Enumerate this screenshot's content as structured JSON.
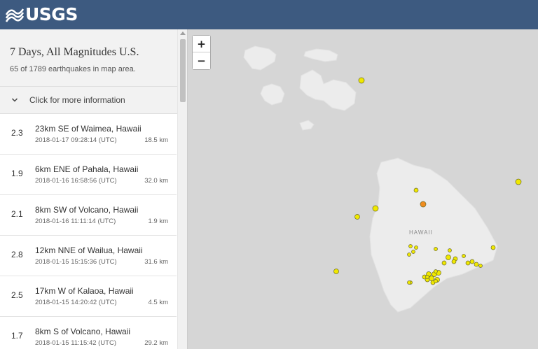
{
  "header": {
    "logo_text": "USGS"
  },
  "summary": {
    "title": "7 Days, All Magnitudes U.S.",
    "count_text": "65 of 1789 earthquakes in map area."
  },
  "more_info": {
    "label": "Click for more information"
  },
  "earthquakes": [
    {
      "mag": "2.3",
      "place": "23km SE of Waimea, Hawaii",
      "time": "2018-01-17 09:28:14 (UTC)",
      "depth": "18.5 km"
    },
    {
      "mag": "1.9",
      "place": "6km ENE of Pahala, Hawaii",
      "time": "2018-01-16 16:58:56 (UTC)",
      "depth": "32.0 km"
    },
    {
      "mag": "2.1",
      "place": "8km SW of Volcano, Hawaii",
      "time": "2018-01-16 11:11:14 (UTC)",
      "depth": "1.9 km"
    },
    {
      "mag": "2.8",
      "place": "12km NNE of Wailua, Hawaii",
      "time": "2018-01-15 15:15:36 (UTC)",
      "depth": "31.6 km"
    },
    {
      "mag": "2.5",
      "place": "17km W of Kalaoa, Hawaii",
      "time": "2018-01-15 14:20:42 (UTC)",
      "depth": "4.5 km"
    },
    {
      "mag": "1.7",
      "place": "8km S of Volcano, Hawaii",
      "time": "2018-01-15 11:15:42 (UTC)",
      "depth": "29.2 km"
    }
  ],
  "map": {
    "zoom_in": "+",
    "zoom_out": "−",
    "island_label": "HAWAII"
  },
  "colors": {
    "header_bg": "#3d5a80",
    "map_bg": "#d6d6d6",
    "land": "#ececec",
    "quake_yellow": "#f0e800",
    "quake_orange": "#f08c1e"
  }
}
